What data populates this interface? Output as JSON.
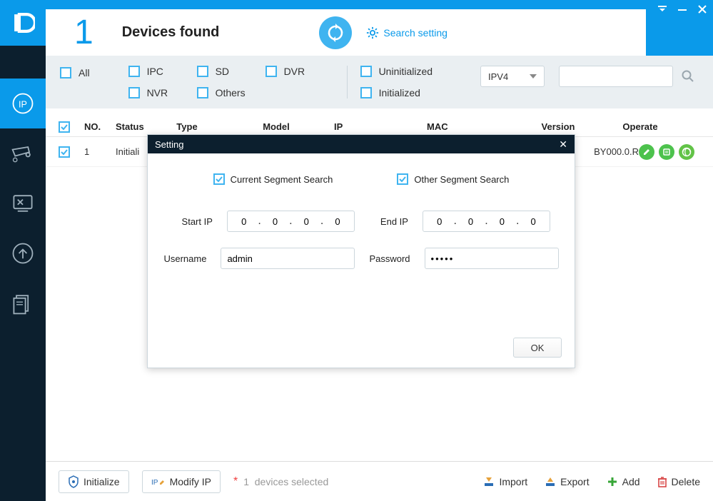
{
  "header": {
    "count": "1",
    "devices_found": "Devices found",
    "search_setting": "Search setting"
  },
  "filters": {
    "all": "All",
    "ipc": "IPC",
    "sd": "SD",
    "dvr": "DVR",
    "nvr": "NVR",
    "others": "Others",
    "uninitialized": "Uninitialized",
    "initialized": "Initialized",
    "ipver": "IPV4"
  },
  "table": {
    "headers": {
      "no": "NO.",
      "status": "Status",
      "type": "Type",
      "model": "Model",
      "ip": "IP",
      "mac": "MAC",
      "version": "Version",
      "operate": "Operate"
    }
  },
  "row": {
    "no": "1",
    "status": "Initiali",
    "version_tail": "BY000.0.R"
  },
  "bottom": {
    "initialize": "Initialize",
    "modify_ip": "Modify IP",
    "devices_selected_count": "1",
    "devices_selected_label": "devices selected",
    "import": "Import",
    "export": "Export",
    "add": "Add",
    "delete": "Delete"
  },
  "modal": {
    "title": "Setting",
    "current_segment": "Current Segment Search",
    "other_segment": "Other Segment Search",
    "start_ip_label": "Start IP",
    "end_ip_label": "End IP",
    "start_ip": [
      "0",
      "0",
      "0",
      "0"
    ],
    "end_ip": [
      "0",
      "0",
      "0",
      "0"
    ],
    "username_label": "Username",
    "password_label": "Password",
    "username_value": "admin",
    "password_value": "•••••",
    "ok": "OK"
  }
}
